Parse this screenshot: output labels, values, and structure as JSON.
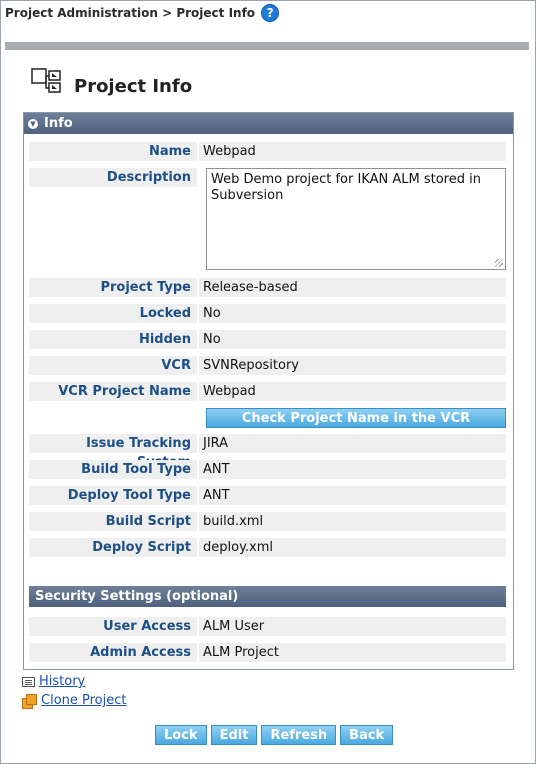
{
  "breadcrumb": {
    "text": "Project Administration > Project Info",
    "help": "?"
  },
  "page": {
    "title": "Project Info"
  },
  "info_section": {
    "title": "Info"
  },
  "fields": {
    "name": {
      "label": "Name",
      "value": "Webpad"
    },
    "description": {
      "label": "Description",
      "value": "Web Demo project for IKAN ALM stored in Subversion"
    },
    "project_type": {
      "label": "Project Type",
      "value": "Release-based"
    },
    "locked": {
      "label": "Locked",
      "value": "No"
    },
    "hidden": {
      "label": "Hidden",
      "value": "No"
    },
    "vcr": {
      "label": "VCR",
      "value": "SVNRepository"
    },
    "vcr_project_name": {
      "label": "VCR Project Name",
      "value": "Webpad"
    },
    "issue_tracking": {
      "label": "Issue Tracking System",
      "value": "JIRA"
    },
    "build_tool": {
      "label": "Build Tool Type",
      "value": "ANT"
    },
    "deploy_tool": {
      "label": "Deploy Tool Type",
      "value": "ANT"
    },
    "build_script": {
      "label": "Build Script",
      "value": "build.xml"
    },
    "deploy_script": {
      "label": "Deploy Script",
      "value": "deploy.xml"
    }
  },
  "check_vcr_button": "Check Project Name in the VCR",
  "security_section": {
    "title": "Security Settings (optional)",
    "user_access": {
      "label": "User Access",
      "value": "ALM User"
    },
    "admin_access": {
      "label": "Admin Access",
      "value": "ALM Project"
    }
  },
  "links": {
    "history": "History",
    "clone": "Clone Project"
  },
  "buttons": {
    "lock": "Lock",
    "edit": "Edit",
    "refresh": "Refresh",
    "back": "Back"
  }
}
